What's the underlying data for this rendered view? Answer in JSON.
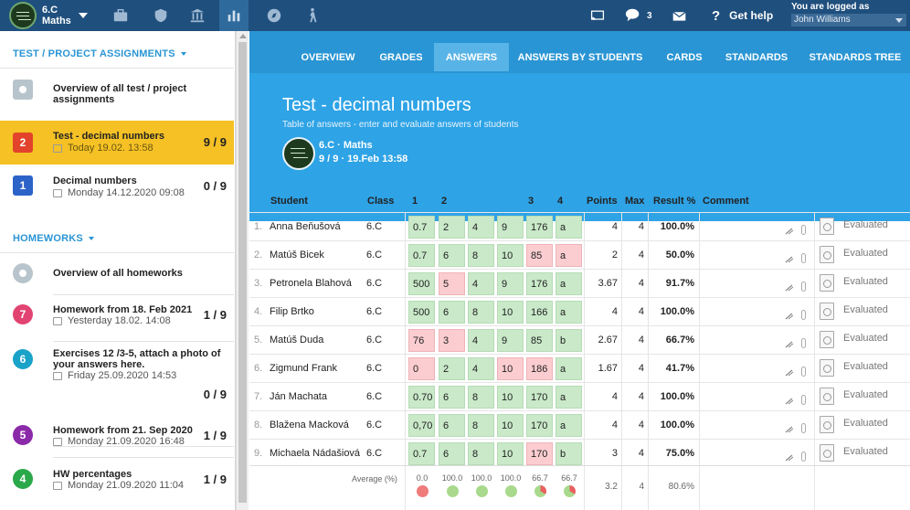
{
  "header": {
    "class_line1": "6.C",
    "class_line2": "Maths",
    "help_label": "Get help",
    "messages_count": "3",
    "logged_label": "You are logged as",
    "user_name": "John Williams"
  },
  "sidebar": {
    "sections": {
      "tests_title": "TEST / PROJECT ASSIGNMENTS",
      "homeworks_title": "HOMEWORKS"
    },
    "tests": [
      {
        "badge": "",
        "title": "Overview of all test / project assignments",
        "sub": "",
        "count": ""
      },
      {
        "badge": "2",
        "title": "Test - decimal numbers",
        "sub": "Today 19.02. 13:58",
        "count": "9 / 9",
        "color": "#e2432a"
      },
      {
        "badge": "1",
        "title": "Decimal numbers",
        "sub": "Monday 14.12.2020 09:08",
        "count": "0 / 9",
        "color": "#2c63c8"
      }
    ],
    "homeworks": [
      {
        "badge": "",
        "title": "Overview of all homeworks",
        "sub": "",
        "count": ""
      },
      {
        "badge": "7",
        "title": "Homework from 18. Feb 2021",
        "sub": "Yesterday 18.02. 14:08",
        "count": "1 / 9",
        "color": "#e24472"
      },
      {
        "badge": "6",
        "title": "Exercises 12 /3-5, attach a photo of your answers here.",
        "sub": "Friday 25.09.2020 14:53",
        "count": "0 / 9",
        "color": "#1aa2c8"
      },
      {
        "badge": "5",
        "title": "Homework from 21. Sep 2020",
        "sub": "Monday 21.09.2020 16:48",
        "count": "1 / 9",
        "color": "#8b2aa8"
      },
      {
        "badge": "4",
        "title": "HW percentages",
        "sub": "Monday 21.09.2020 11:04",
        "count": "1 / 9",
        "color": "#2aa84a"
      }
    ]
  },
  "tabs": [
    "OVERVIEW",
    "GRADES",
    "ANSWERS",
    "ANSWERS BY STUDENTS",
    "CARDS",
    "STANDARDS",
    "STANDARDS TREE"
  ],
  "hero": {
    "title": "Test - decimal numbers",
    "subtitle": "Table of answers - enter and evaluate answers of students",
    "info1": "6.C · Maths",
    "info2": "9 / 9 · 19.Feb 13:58"
  },
  "table": {
    "headers": {
      "student": "Student",
      "class": "Class",
      "q1": "1",
      "q2": "2",
      "q3": "3",
      "q4": "4",
      "points": "Points",
      "max": "Max",
      "result": "Result %",
      "comment": "Comment"
    },
    "rows": [
      {
        "num": "1.",
        "name": "Anna Beňušová",
        "cls": "6.C",
        "a": [
          "0.7",
          "2",
          "4",
          "9",
          "176",
          "a"
        ],
        "s": [
          1,
          1,
          1,
          1,
          1,
          1
        ],
        "points": "4",
        "max": "4",
        "result": "100.0%",
        "status": "Evaluated"
      },
      {
        "num": "2.",
        "name": "Matúš Bicek",
        "cls": "6.C",
        "a": [
          "0.7",
          "6",
          "8",
          "10",
          "85",
          "a"
        ],
        "s": [
          1,
          1,
          1,
          1,
          0,
          0
        ],
        "points": "2",
        "max": "4",
        "result": "50.0%",
        "status": "Evaluated"
      },
      {
        "num": "3.",
        "name": "Petronela Blahová",
        "cls": "6.C",
        "a": [
          "500",
          "5",
          "4",
          "9",
          "176",
          "a"
        ],
        "s": [
          1,
          0,
          1,
          1,
          1,
          1
        ],
        "points": "3.67",
        "max": "4",
        "result": "91.7%",
        "status": "Evaluated"
      },
      {
        "num": "4.",
        "name": "Filip Brtko",
        "cls": "6.C",
        "a": [
          "500",
          "6",
          "8",
          "10",
          "166",
          "a"
        ],
        "s": [
          1,
          1,
          1,
          1,
          1,
          1
        ],
        "points": "4",
        "max": "4",
        "result": "100.0%",
        "status": "Evaluated"
      },
      {
        "num": "5.",
        "name": "Matúš Duda",
        "cls": "6.C",
        "a": [
          "76",
          "3",
          "4",
          "9",
          "85",
          "b"
        ],
        "s": [
          0,
          0,
          1,
          1,
          1,
          1
        ],
        "points": "2.67",
        "max": "4",
        "result": "66.7%",
        "status": "Evaluated"
      },
      {
        "num": "6.",
        "name": "Zigmund Frank",
        "cls": "6.C",
        "a": [
          "0",
          "2",
          "4",
          "10",
          "186",
          "a"
        ],
        "s": [
          0,
          1,
          1,
          0,
          0,
          1
        ],
        "points": "1.67",
        "max": "4",
        "result": "41.7%",
        "status": "Evaluated"
      },
      {
        "num": "7.",
        "name": "Ján Machata",
        "cls": "6.C",
        "a": [
          "0.70",
          "6",
          "8",
          "10",
          "170",
          "a"
        ],
        "s": [
          1,
          1,
          1,
          1,
          1,
          1
        ],
        "points": "4",
        "max": "4",
        "result": "100.0%",
        "status": "Evaluated"
      },
      {
        "num": "8.",
        "name": "Blažena Macková",
        "cls": "6.C",
        "a": [
          "0,70",
          "6",
          "8",
          "10",
          "170",
          "a"
        ],
        "s": [
          1,
          1,
          1,
          1,
          1,
          1
        ],
        "points": "4",
        "max": "4",
        "result": "100.0%",
        "status": "Evaluated"
      },
      {
        "num": "9.",
        "name": "Michaela Nádašiová",
        "cls": "6.C",
        "a": [
          "0.7",
          "6",
          "8",
          "10",
          "170",
          "b"
        ],
        "s": [
          1,
          1,
          1,
          1,
          0,
          1
        ],
        "points": "3",
        "max": "4",
        "result": "75.0%",
        "status": "Evaluated"
      }
    ],
    "average": {
      "label": "Average (%)",
      "values": [
        "0.0",
        "100.0",
        "100.0",
        "100.0",
        "66.7",
        "66.7"
      ],
      "dots": [
        "red",
        "green",
        "green",
        "green",
        "mix",
        "mix"
      ],
      "points": "3.2",
      "max": "4",
      "result": "80.6%"
    }
  },
  "colors": {
    "topbar": "#1f4f7d",
    "tabs": "#2a95d4",
    "hero": "#2ea3e6",
    "highlight": "#f5c125",
    "ok": "#c9e9c9",
    "bad": "#fbcdd0"
  }
}
